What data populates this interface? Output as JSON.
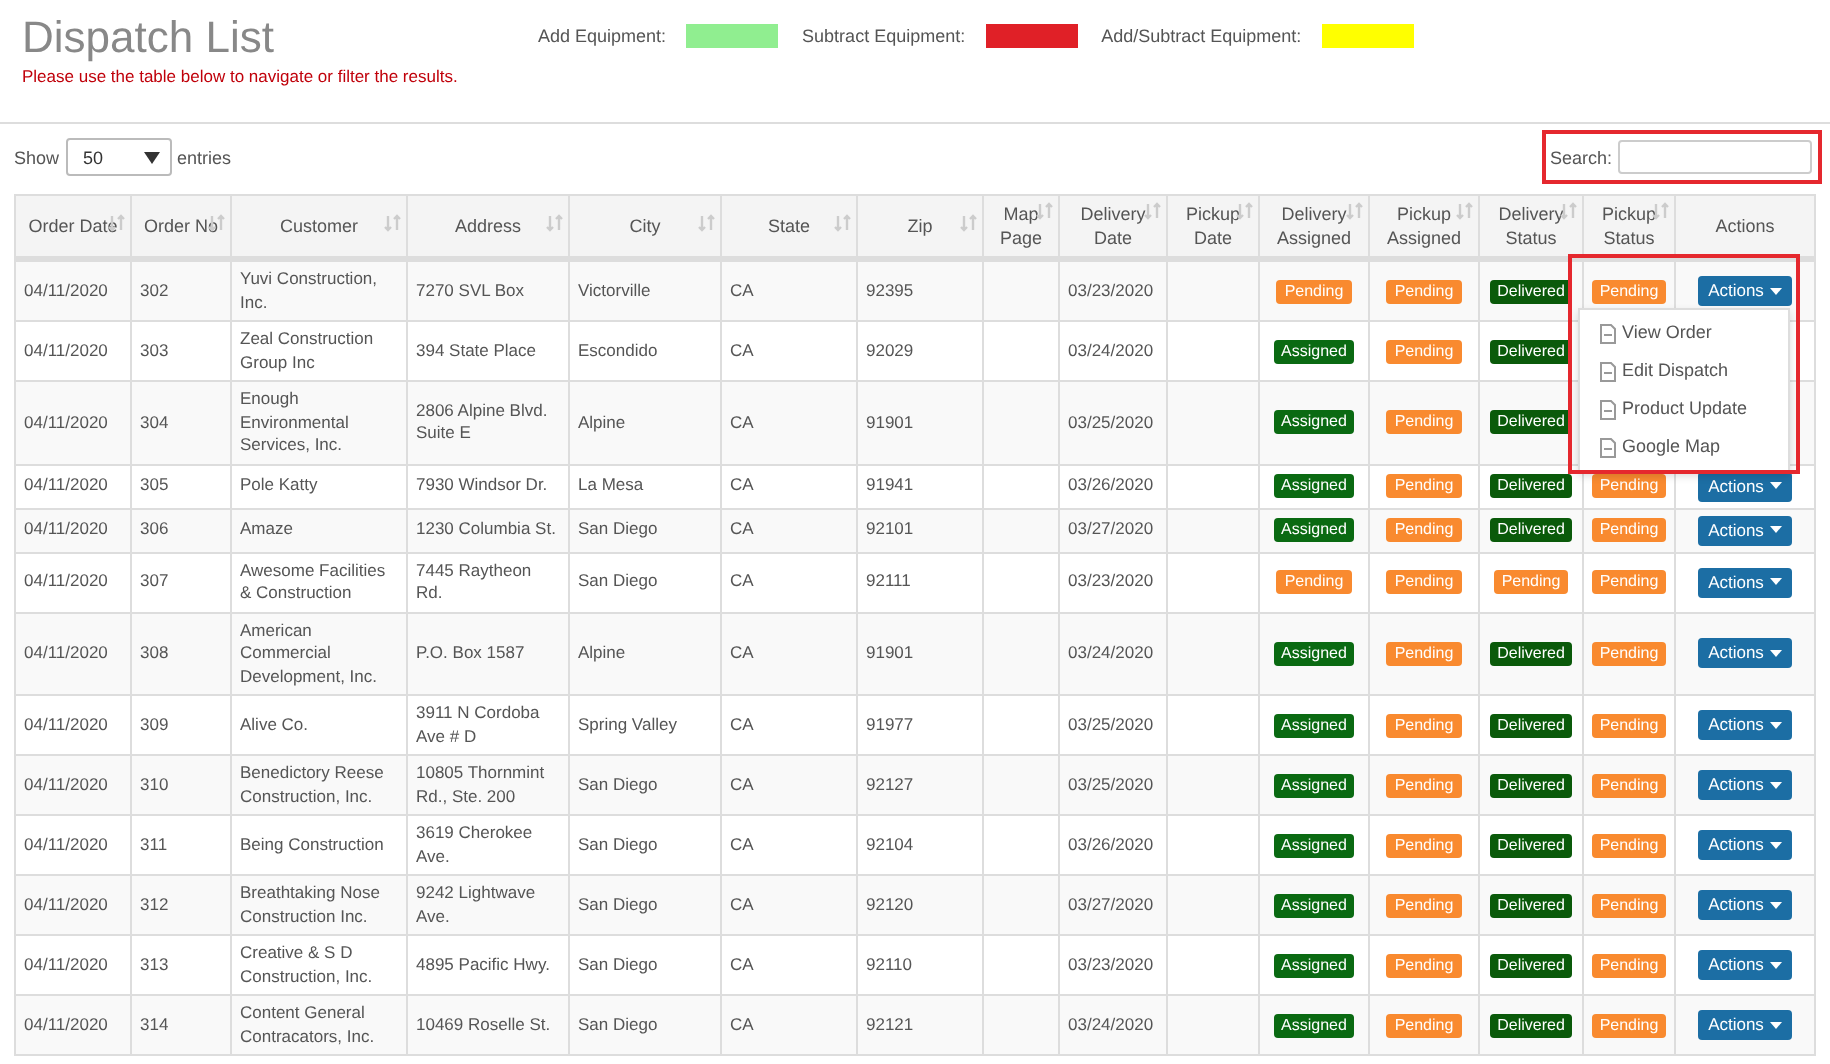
{
  "header": {
    "title": "Dispatch List",
    "subtitle": "Please use the table below to navigate or filter the results."
  },
  "legend": [
    {
      "label": "Add Equipment:",
      "color": "#90ee90"
    },
    {
      "label": "Subtract Equipment:",
      "color": "#e02027"
    },
    {
      "label": "Add/Subtract Equipment:",
      "color": "#ffff00"
    }
  ],
  "length_menu": {
    "label_before": "Show",
    "value": "50",
    "label_after": "entries"
  },
  "search": {
    "label": "Search:",
    "highlighted": true
  },
  "table": {
    "columns": [
      {
        "label": "Order Date",
        "sortable": true
      },
      {
        "label": "Order No",
        "sortable": true
      },
      {
        "label": "Customer",
        "sortable": true
      },
      {
        "label": "Address",
        "sortable": true
      },
      {
        "label": "City",
        "sortable": true
      },
      {
        "label": "State",
        "sortable": true
      },
      {
        "label": "Zip",
        "sortable": true
      },
      {
        "label": "Map Page",
        "sortable": true
      },
      {
        "label": "Delivery Date",
        "sortable": true
      },
      {
        "label": "Pickup Date",
        "sortable": true
      },
      {
        "label": "Delivery Assigned",
        "sortable": true
      },
      {
        "label": "Pickup Assigned",
        "sortable": true
      },
      {
        "label": "Delivery Status",
        "sortable": true
      },
      {
        "label": "Pickup Status",
        "sortable": true
      },
      {
        "label": "Actions",
        "sortable": false
      }
    ],
    "rows": [
      {
        "order_date": "04/11/2020",
        "order_no": "302",
        "customer": "Yuvi Construction, Inc.",
        "address": "7270 SVL Box",
        "city": "Victorville",
        "state": "CA",
        "zip": "92395",
        "delivery_date": "03/23/2020",
        "delivery_assigned": {
          "text": "Pending",
          "kind": "pending"
        },
        "pickup_assigned": {
          "text": "Pending",
          "kind": "pending"
        },
        "delivery_status": {
          "text": "Delivered",
          "kind": "delivered"
        },
        "pickup_status": {
          "text": "Pending",
          "kind": "pending"
        },
        "action": "Actions"
      },
      {
        "order_date": "04/11/2020",
        "order_no": "303",
        "customer": "Zeal Construction Group Inc",
        "address": "394 State Place",
        "city": "Escondido",
        "state": "CA",
        "zip": "92029",
        "delivery_date": "03/24/2020",
        "delivery_assigned": {
          "text": "Assigned",
          "kind": "assigned"
        },
        "pickup_assigned": {
          "text": "Pending",
          "kind": "pending"
        },
        "delivery_status": {
          "text": "Delivered",
          "kind": "delivered"
        }
      },
      {
        "order_date": "04/11/2020",
        "order_no": "304",
        "customer": "Enough Environmental Services, Inc.",
        "address": "2806 Alpine Blvd. Suite E",
        "city": "Alpine",
        "state": "CA",
        "zip": "91901",
        "delivery_date": "03/25/2020",
        "delivery_assigned": {
          "text": "Assigned",
          "kind": "assigned"
        },
        "pickup_assigned": {
          "text": "Pending",
          "kind": "pending"
        },
        "delivery_status": {
          "text": "Delivered",
          "kind": "delivered"
        }
      },
      {
        "order_date": "04/11/2020",
        "order_no": "305",
        "customer": "Pole Katty",
        "address": "7930 Windsor Dr.",
        "city": "La Mesa",
        "state": "CA",
        "zip": "91941",
        "delivery_date": "03/26/2020",
        "delivery_assigned": {
          "text": "Assigned",
          "kind": "assigned"
        },
        "pickup_assigned": {
          "text": "Pending",
          "kind": "pending"
        },
        "delivery_status": {
          "text": "Delivered",
          "kind": "delivered"
        },
        "pickup_status": {
          "text": "Pending",
          "kind": "pending"
        },
        "action": "Actions"
      },
      {
        "order_date": "04/11/2020",
        "order_no": "306",
        "customer": "Amaze",
        "address": "1230 Columbia St.",
        "city": "San Diego",
        "state": "CA",
        "zip": "92101",
        "delivery_date": "03/27/2020",
        "delivery_assigned": {
          "text": "Assigned",
          "kind": "assigned"
        },
        "pickup_assigned": {
          "text": "Pending",
          "kind": "pending"
        },
        "delivery_status": {
          "text": "Delivered",
          "kind": "delivered"
        },
        "pickup_status": {
          "text": "Pending",
          "kind": "pending"
        },
        "action": "Actions"
      },
      {
        "order_date": "04/11/2020",
        "order_no": "307",
        "customer": "Awesome Facilities & Construction",
        "address": "7445 Raytheon Rd.",
        "city": "San Diego",
        "state": "CA",
        "zip": "92111",
        "delivery_date": "03/23/2020",
        "delivery_assigned": {
          "text": "Pending",
          "kind": "pending"
        },
        "pickup_assigned": {
          "text": "Pending",
          "kind": "pending"
        },
        "delivery_status": {
          "text": "Pending",
          "kind": "pending"
        },
        "pickup_status": {
          "text": "Pending",
          "kind": "pending"
        },
        "action": "Actions"
      },
      {
        "order_date": "04/11/2020",
        "order_no": "308",
        "customer": "American Commercial Development, Inc.",
        "address": "P.O. Box 1587",
        "city": "Alpine",
        "state": "CA",
        "zip": "91901",
        "delivery_date": "03/24/2020",
        "delivery_assigned": {
          "text": "Assigned",
          "kind": "assigned"
        },
        "pickup_assigned": {
          "text": "Pending",
          "kind": "pending"
        },
        "delivery_status": {
          "text": "Delivered",
          "kind": "delivered"
        },
        "pickup_status": {
          "text": "Pending",
          "kind": "pending"
        },
        "action": "Actions"
      },
      {
        "order_date": "04/11/2020",
        "order_no": "309",
        "customer": "Alive Co.",
        "address": "3911 N Cordoba Ave # D",
        "city": "Spring Valley",
        "state": "CA",
        "zip": "91977",
        "delivery_date": "03/25/2020",
        "delivery_assigned": {
          "text": "Assigned",
          "kind": "assigned"
        },
        "pickup_assigned": {
          "text": "Pending",
          "kind": "pending"
        },
        "delivery_status": {
          "text": "Delivered",
          "kind": "delivered"
        },
        "pickup_status": {
          "text": "Pending",
          "kind": "pending"
        },
        "action": "Actions"
      },
      {
        "order_date": "04/11/2020",
        "order_no": "310",
        "customer": "Benedictory Reese Construction, Inc.",
        "address": "10805 Thornmint Rd., Ste. 200",
        "city": "San Diego",
        "state": "CA",
        "zip": "92127",
        "delivery_date": "03/25/2020",
        "delivery_assigned": {
          "text": "Assigned",
          "kind": "assigned"
        },
        "pickup_assigned": {
          "text": "Pending",
          "kind": "pending"
        },
        "delivery_status": {
          "text": "Delivered",
          "kind": "delivered"
        },
        "pickup_status": {
          "text": "Pending",
          "kind": "pending"
        },
        "action": "Actions"
      },
      {
        "order_date": "04/11/2020",
        "order_no": "311",
        "customer": "Being Construction",
        "address": "3619 Cherokee Ave.",
        "city": "San Diego",
        "state": "CA",
        "zip": "92104",
        "delivery_date": "03/26/2020",
        "delivery_assigned": {
          "text": "Assigned",
          "kind": "assigned"
        },
        "pickup_assigned": {
          "text": "Pending",
          "kind": "pending"
        },
        "delivery_status": {
          "text": "Delivered",
          "kind": "delivered"
        },
        "pickup_status": {
          "text": "Pending",
          "kind": "pending"
        },
        "action": "Actions"
      },
      {
        "order_date": "04/11/2020",
        "order_no": "312",
        "customer": "Breathtaking Nose Construction Inc.",
        "address": "9242 Lightwave Ave.",
        "city": "San Diego",
        "state": "CA",
        "zip": "92120",
        "delivery_date": "03/27/2020",
        "delivery_assigned": {
          "text": "Assigned",
          "kind": "assigned"
        },
        "pickup_assigned": {
          "text": "Pending",
          "kind": "pending"
        },
        "delivery_status": {
          "text": "Delivered",
          "kind": "delivered"
        },
        "pickup_status": {
          "text": "Pending",
          "kind": "pending"
        },
        "action": "Actions"
      },
      {
        "order_date": "04/11/2020",
        "order_no": "313",
        "customer": "Creative & S D Construction, Inc.",
        "address": "4895 Pacific Hwy.",
        "city": "San Diego",
        "state": "CA",
        "zip": "92110",
        "delivery_date": "03/23/2020",
        "delivery_assigned": {
          "text": "Assigned",
          "kind": "assigned"
        },
        "pickup_assigned": {
          "text": "Pending",
          "kind": "pending"
        },
        "delivery_status": {
          "text": "Delivered",
          "kind": "delivered"
        },
        "pickup_status": {
          "text": "Pending",
          "kind": "pending"
        },
        "action": "Actions"
      },
      {
        "order_date": "04/11/2020",
        "order_no": "314",
        "customer": "Content General Contracators, Inc.",
        "address": "10469 Roselle St.",
        "city": "San Diego",
        "state": "CA",
        "zip": "92121",
        "delivery_date": "03/24/2020",
        "delivery_assigned": {
          "text": "Assigned",
          "kind": "assigned"
        },
        "pickup_assigned": {
          "text": "Pending",
          "kind": "pending"
        },
        "delivery_status": {
          "text": "Delivered",
          "kind": "delivered"
        },
        "pickup_status": {
          "text": "Pending",
          "kind": "pending"
        },
        "action": "Actions"
      }
    ]
  },
  "actions_menu": {
    "highlighted": true,
    "items": [
      "View Order",
      "Edit Dispatch",
      "Product Update",
      "Google Map"
    ]
  }
}
